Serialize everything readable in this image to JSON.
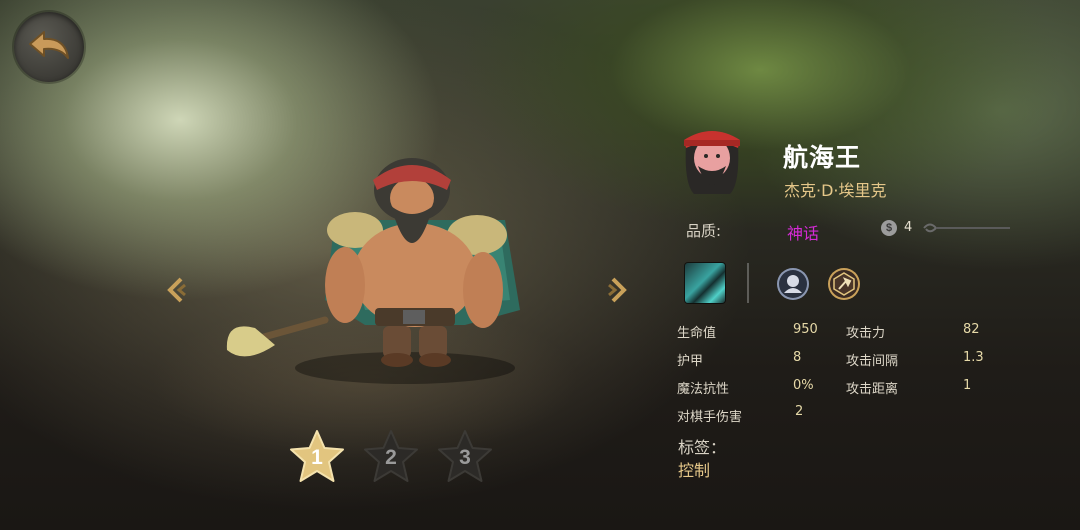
{
  "hero": {
    "name": "航海王",
    "subname": "杰克·D·埃里克",
    "quality_label": "品质:",
    "quality_value": "神话",
    "quality_color": "#d52ad6",
    "cost": "4",
    "stars": [
      "1",
      "2",
      "3"
    ],
    "selected_star": "1"
  },
  "stats": {
    "hp_label": "生命值",
    "hp_value": "950",
    "armor_label": "护甲",
    "armor_value": "8",
    "mr_label": "魔法抗性",
    "mr_value": "0%",
    "player_dmg_label": "对棋手伤害",
    "player_dmg_value": "2",
    "atk_label": "攻击力",
    "atk_value": "82",
    "atk_interval_label": "攻击间隔",
    "atk_interval_value": "1.3",
    "atk_range_label": "攻击距离",
    "atk_range_value": "1"
  },
  "tags": {
    "label": "标签：",
    "value": "控制"
  },
  "icons": {
    "back": "back-arrow-icon",
    "prev": "chevron-left-icon",
    "next": "chevron-right-icon",
    "cost": "coin-icon",
    "skill": "skill-icon",
    "race": "race-trait-icon",
    "class": "class-trait-icon"
  }
}
